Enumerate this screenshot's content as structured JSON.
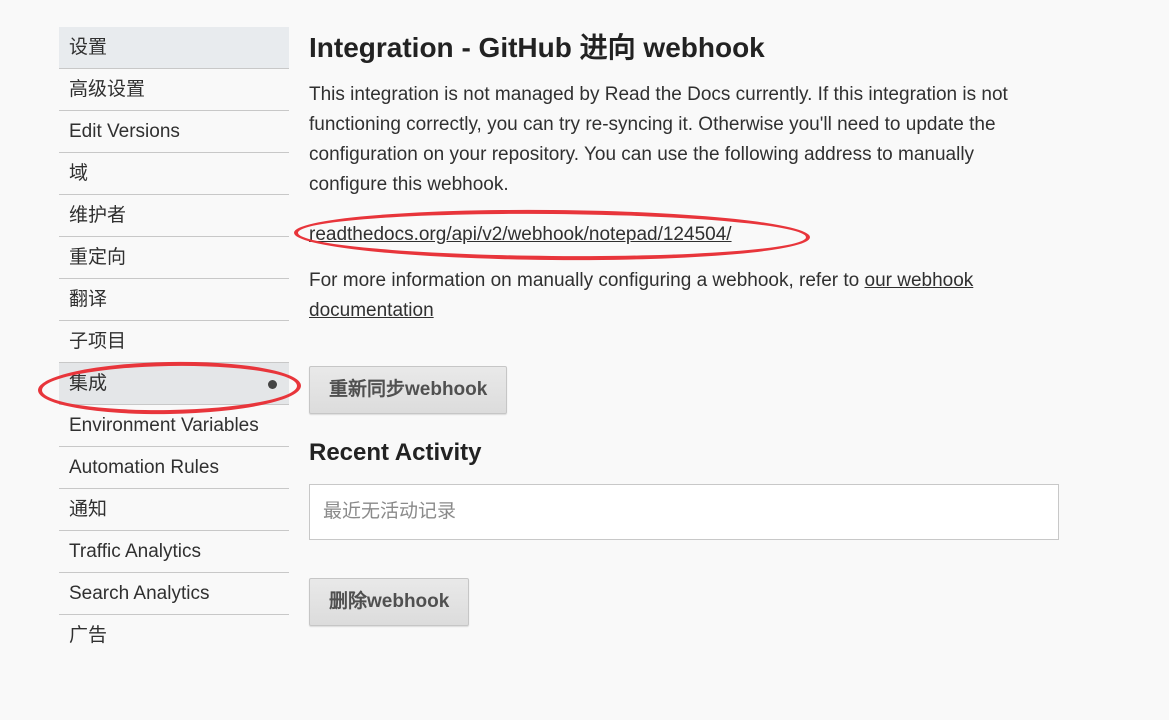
{
  "sidebar": {
    "items": [
      {
        "label": "设置"
      },
      {
        "label": "高级设置"
      },
      {
        "label": "Edit Versions"
      },
      {
        "label": "域"
      },
      {
        "label": "维护者"
      },
      {
        "label": "重定向"
      },
      {
        "label": "翻译"
      },
      {
        "label": "子项目"
      },
      {
        "label": "集成"
      },
      {
        "label": "Environment Variables"
      },
      {
        "label": "Automation Rules"
      },
      {
        "label": "通知"
      },
      {
        "label": "Traffic Analytics"
      },
      {
        "label": "Search Analytics"
      },
      {
        "label": "广告"
      }
    ]
  },
  "main": {
    "title": "Integration - GitHub 进向 webhook",
    "description": "This integration is not managed by Read the Docs currently. If this integration is not functioning correctly, you can try re-syncing it. Otherwise you'll need to update the configuration on your repository. You can use the following address to manually configure this webhook.",
    "webhook_url": "readthedocs.org/api/v2/webhook/notepad/124504/",
    "more_info_prefix": "For more information on manually configuring a webhook, refer to ",
    "more_info_link": "our webhook documentation",
    "resync_button": "重新同步webhook",
    "recent_activity_title": "Recent Activity",
    "recent_activity_empty": "最近无活动记录",
    "delete_button": "删除webhook"
  },
  "colors": {
    "annotation": "#e8353b",
    "background": "#f9f9f9",
    "active_item_bg": "#e4e6e8"
  }
}
